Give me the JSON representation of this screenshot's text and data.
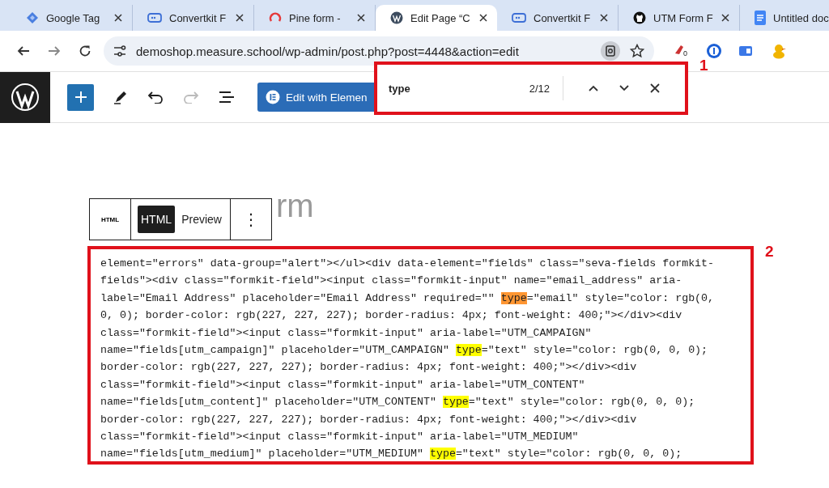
{
  "browser": {
    "tabs": [
      {
        "title": "Google Tag",
        "selected": false
      },
      {
        "title": "Convertkit F",
        "selected": false
      },
      {
        "title": "Pine form -",
        "selected": false
      },
      {
        "title": "Edit Page “C",
        "selected": true
      },
      {
        "title": "Convertkit F",
        "selected": false
      },
      {
        "title": "UTM Form F",
        "selected": false
      },
      {
        "title": "Untitled doc",
        "selected": false
      }
    ],
    "address": "demoshop.measure.school/wp-admin/post.php?post=4448&action=edit",
    "extension_badge": "0"
  },
  "editor_toolbar": {
    "elementor_button": "Edit with Elemen"
  },
  "find_bar": {
    "query": "type",
    "count": "2/12"
  },
  "page_title": "rm",
  "block_toolbar": {
    "block_type": "HTML",
    "tabs": [
      {
        "label": "HTML",
        "selected": true
      },
      {
        "label": "Preview",
        "selected": false
      }
    ],
    "more": "⋮"
  },
  "code": {
    "lines": [
      [
        {
          "text": "element=\"errors\" data-group=\"alert\"></ul><div data-element=\"fields\" class=\"seva-fields formkit-",
          "kind": "plain"
        }
      ],
      [
        {
          "text": "fields\"><div class=\"formkit-field\"><input class=\"formkit-input\" name=\"email_address\" aria-",
          "kind": "plain"
        }
      ],
      [
        {
          "text": "label=\"Email Address\" placeholder=\"Email Address\" required=\"\" ",
          "kind": "plain"
        },
        {
          "text": "type",
          "kind": "current_match"
        },
        {
          "text": "=\"email\" style=\"color: rgb(0,",
          "kind": "plain"
        }
      ],
      [
        {
          "text": "0, 0); border-color: rgb(227, 227, 227); border-radius: 4px; font-weight: 400;\"></div><div",
          "kind": "plain"
        }
      ],
      [
        {
          "text": "class=\"formkit-field\"><input class=\"formkit-input\" aria-label=\"UTM_CAMPAIGN\"",
          "kind": "plain"
        }
      ],
      [
        {
          "text": "name=\"fields[utm_campaign]\" placeholder=\"UTM_CAMPAIGN\" ",
          "kind": "plain"
        },
        {
          "text": "type",
          "kind": "match"
        },
        {
          "text": "=\"text\" style=\"color: rgb(0, 0, 0);",
          "kind": "plain"
        }
      ],
      [
        {
          "text": "border-color: rgb(227, 227, 227); border-radius: 4px; font-weight: 400;\"></div><div",
          "kind": "plain"
        }
      ],
      [
        {
          "text": "class=\"formkit-field\"><input class=\"formkit-input\" aria-label=\"UTM_CONTENT\"",
          "kind": "plain"
        }
      ],
      [
        {
          "text": "name=\"fields[utm_content]\" placeholder=\"UTM_CONTENT\" ",
          "kind": "plain"
        },
        {
          "text": "type",
          "kind": "match"
        },
        {
          "text": "=\"text\" style=\"color: rgb(0, 0, 0);",
          "kind": "plain"
        }
      ],
      [
        {
          "text": "border-color: rgb(227, 227, 227); border-radius: 4px; font-weight: 400;\"></div><div",
          "kind": "plain"
        }
      ],
      [
        {
          "text": "class=\"formkit-field\"><input class=\"formkit-input\" aria-label=\"UTM_MEDIUM\"",
          "kind": "plain"
        }
      ],
      [
        {
          "text": "name=\"fields[utm_medium]\" placeholder=\"UTM_MEDIUM\" ",
          "kind": "plain"
        },
        {
          "text": "type",
          "kind": "match"
        },
        {
          "text": "=\"text\" style=\"color: rgb(0, 0, 0);",
          "kind": "plain"
        }
      ]
    ]
  },
  "annotations": [
    {
      "label": "1"
    },
    {
      "label": "2"
    }
  ]
}
